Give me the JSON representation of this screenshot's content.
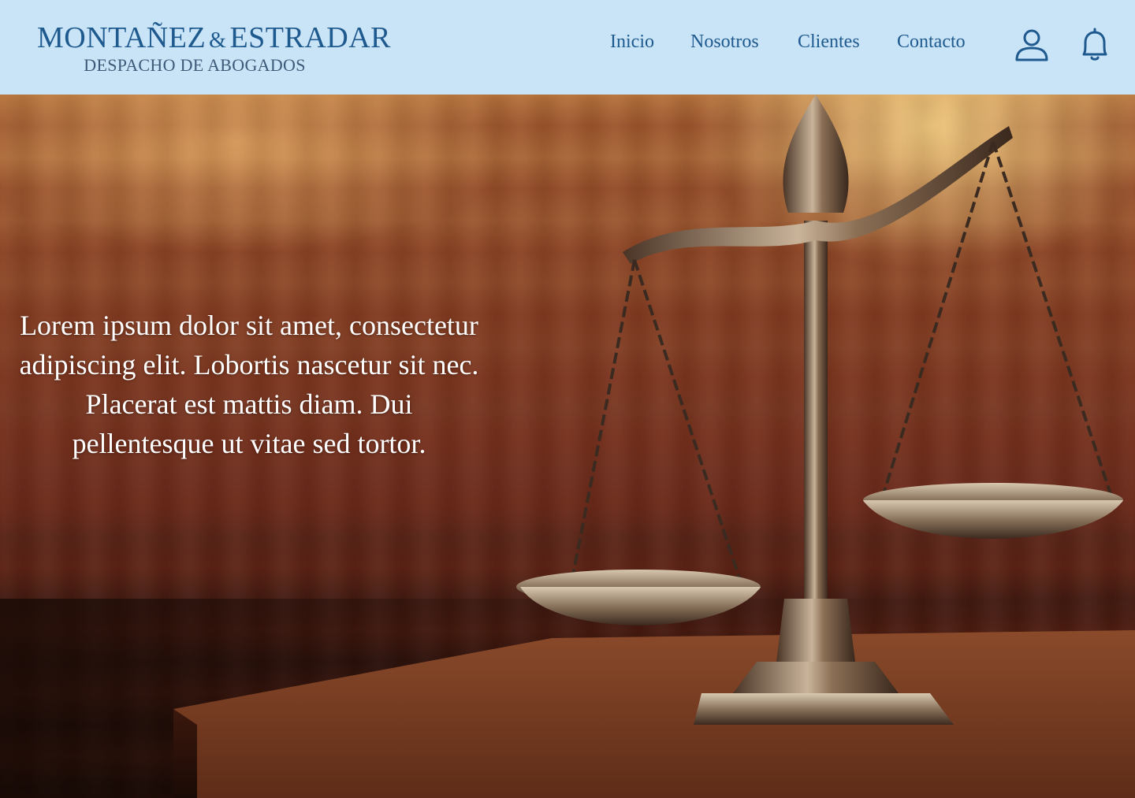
{
  "header": {
    "logo": {
      "name_left": "MONTAÑEZ",
      "ampersand": "&",
      "name_right": "ESTRADAR",
      "tagline": "DESPACHO DE ABOGADOS"
    },
    "nav": [
      {
        "label": "Inicio"
      },
      {
        "label": "Nosotros"
      },
      {
        "label": "Clientes"
      },
      {
        "label": "Contacto"
      }
    ],
    "icons": {
      "user": "user-icon",
      "notifications": "bell-icon"
    }
  },
  "hero": {
    "line1": "Lorem ipsum dolor sit amet, consectetur adipiscing elit. Lobortis nascetur sit nec.",
    "line2": "Placerat est mattis diam. Dui pellentesque ut vitae sed tortor.",
    "image": "scales-of-justice"
  },
  "colors": {
    "header_bg": "#c9e3f7",
    "brand": "#1f5a8f",
    "tagline": "#3d5b78",
    "hero_text": "#ffffff"
  }
}
